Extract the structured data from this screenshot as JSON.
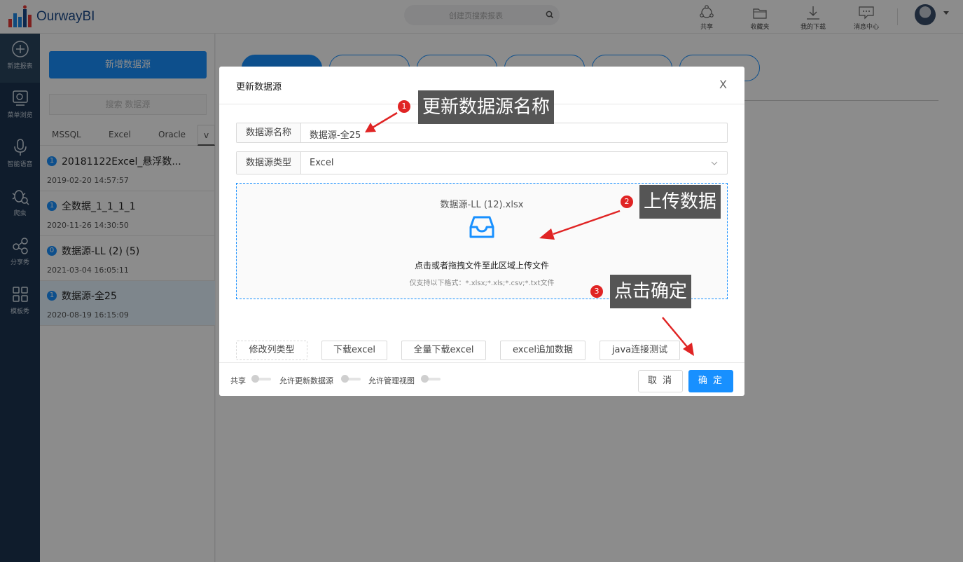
{
  "app": {
    "logo_text": "OurwayBI"
  },
  "header": {
    "search_placeholder": "创建页搜索报表",
    "items": [
      {
        "icon": "share-icon",
        "label": "共享"
      },
      {
        "icon": "favorites-icon",
        "label": "收藏夹"
      },
      {
        "icon": "download-icon",
        "label": "我的下载"
      },
      {
        "icon": "message-icon",
        "label": "消息中心"
      }
    ]
  },
  "leftnav": {
    "items": [
      {
        "icon": "plus-circle-icon",
        "label": "新建报表"
      },
      {
        "icon": "menu-browse-icon",
        "label": "菜单浏览"
      },
      {
        "icon": "microphone-icon",
        "label": "智能语音"
      },
      {
        "icon": "crawler-icon",
        "label": "爬虫"
      },
      {
        "icon": "share-nodes-icon",
        "label": "分享秀"
      },
      {
        "icon": "grid-icon",
        "label": "模板秀"
      }
    ]
  },
  "datasource_panel": {
    "add_button": "新增数据源",
    "search_placeholder": "搜索 数据源",
    "tabs": [
      "MSSQL",
      "Excel",
      "Oracle"
    ],
    "tabs_more": "v",
    "rows": [
      {
        "badge": "1",
        "name": "20181122Excel_悬浮数...",
        "time": "2019-02-20 14:57:57",
        "selected": false
      },
      {
        "badge": "1",
        "name": "全数据_1_1_1_1",
        "time": "2020-11-26 14:30:50",
        "selected": false
      },
      {
        "badge": "0",
        "name": "数据源-LL (2) (5)",
        "time": "2021-03-04 16:05:11",
        "selected": false
      },
      {
        "badge": "1",
        "name": "数据源-全25",
        "time": "2020-08-19 16:15:09",
        "selected": true
      }
    ]
  },
  "modal": {
    "title": "更新数据源",
    "close": "X",
    "name_field": {
      "label": "数据源名称",
      "value": "数据源-全25"
    },
    "type_field": {
      "label": "数据源类型",
      "value": "Excel"
    },
    "upload": {
      "file_name": "数据源-LL (12).xlsx",
      "text": "点击或者拖拽文件至此区域上传文件",
      "hint": "仅支持以下格式：*.xlsx;*.xls;*.csv;*.txt文件"
    },
    "action_buttons": [
      "修改列类型",
      "下载excel",
      "全量下载excel",
      "excel追加数据",
      "java连接测试"
    ],
    "footer": {
      "switches": [
        "共享",
        "允许更新数据源",
        "允许管理视图"
      ],
      "cancel": "取 消",
      "ok": "确 定"
    }
  },
  "annotations": [
    {
      "step": "1",
      "text": "更新数据源名称"
    },
    {
      "step": "2",
      "text": "上传数据"
    },
    {
      "step": "3",
      "text": "点击确定"
    }
  ],
  "colors": {
    "primary": "#1890ff",
    "nav_bg": "#1c3450",
    "annotation_red": "#e02424",
    "callout_bg": "#555555"
  }
}
